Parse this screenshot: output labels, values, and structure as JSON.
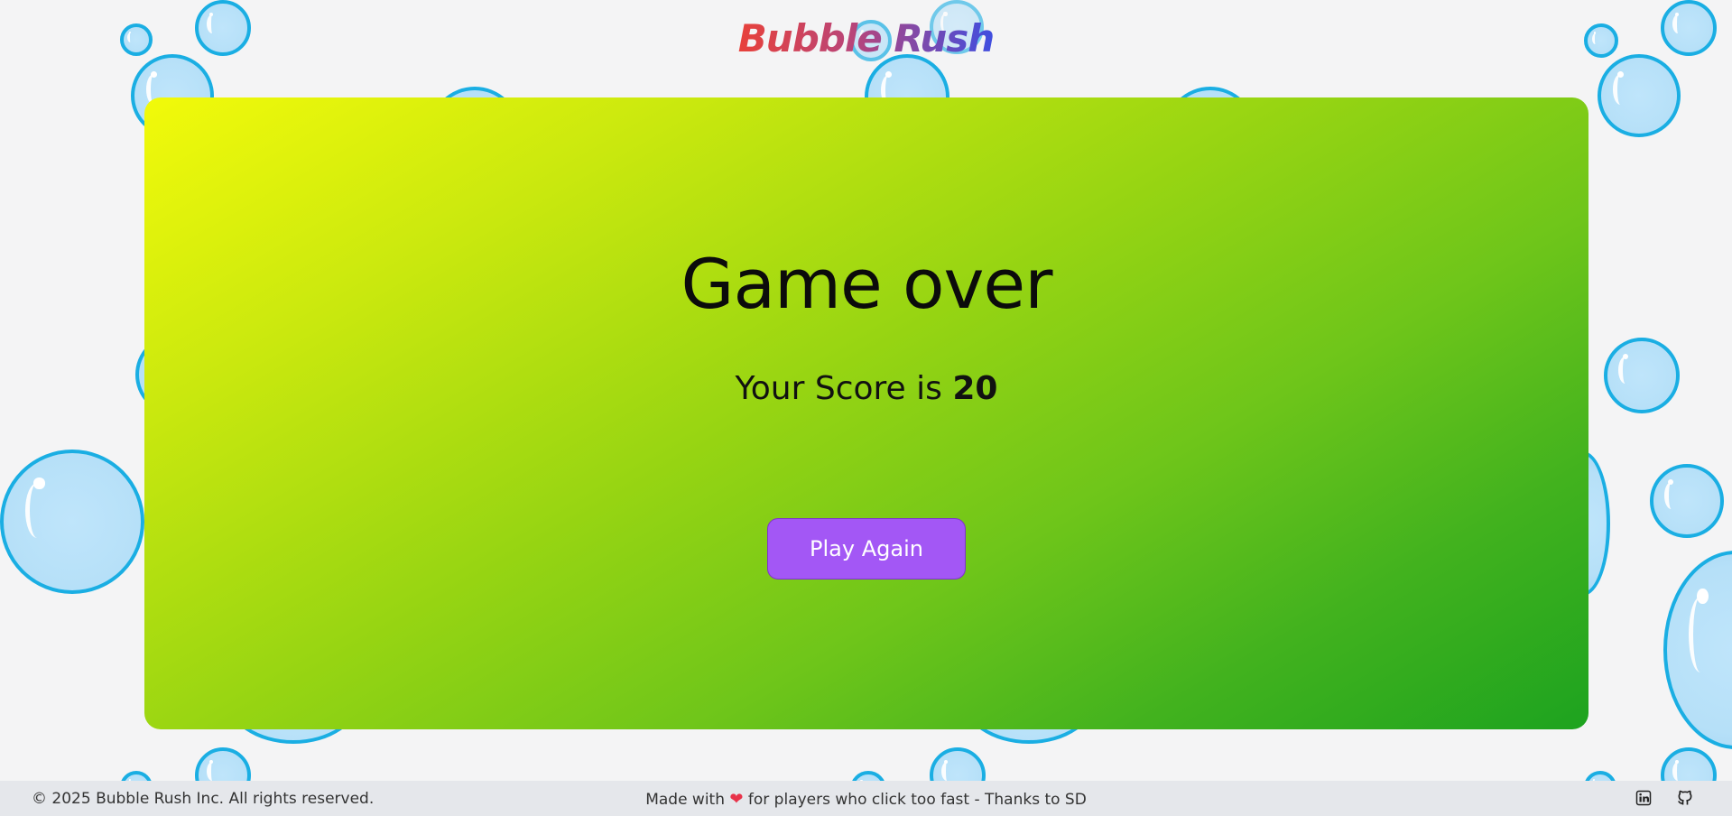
{
  "app": {
    "title": "Bubble Rush",
    "brand_gradient": [
      "#e8413a",
      "#b8457a",
      "#3f4ee0"
    ]
  },
  "game_over": {
    "heading": "Game over",
    "score_prefix": "Your Score is",
    "score_value": "20",
    "play_again_label": "Play Again"
  },
  "footer": {
    "copyright": "© 2025 Bubble Rush Inc. All rights reserved.",
    "made_with_prefix": "Made with",
    "heart": "❤",
    "made_with_suffix": "for players who click too fast - Thanks to SD",
    "links": [
      {
        "icon": "linkedin-icon"
      },
      {
        "icon": "github-icon"
      }
    ]
  },
  "colors": {
    "background": "#f4f4f5",
    "bubble_fill": "#b6e0f8",
    "bubble_border": "#1aaee3",
    "card_gradient_start": "#f2fa0a",
    "card_gradient_end": "#1da31f",
    "button": "#a357f5",
    "footer_bg": "#e5e7eb"
  }
}
